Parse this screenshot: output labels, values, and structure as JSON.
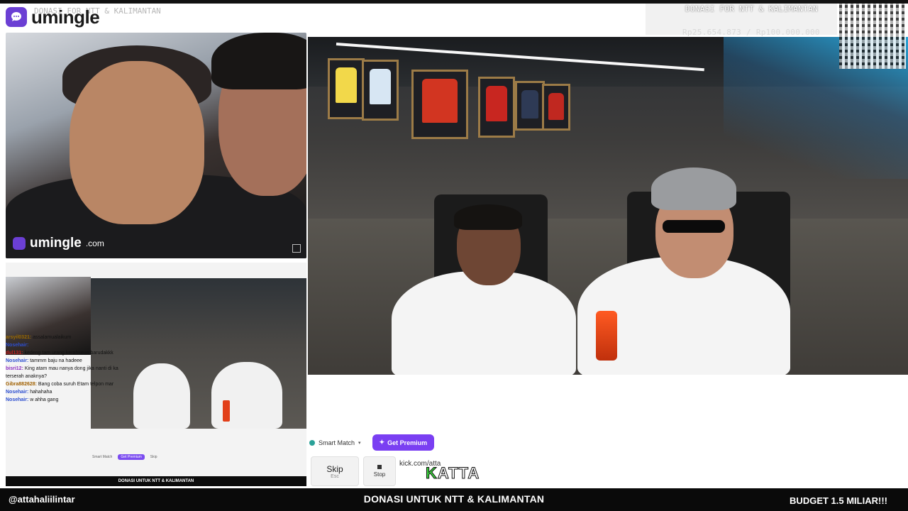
{
  "brand": {
    "logo_text": "umingle",
    "ghost_title": "DONASI FOR NTT & KALIMANTAN",
    "watermark_name": "umingle",
    "watermark_domain": ".com"
  },
  "donation": {
    "title": "DONASI FOR NTT & KALIMANTAN",
    "amount": "Rp25.654.873 / Rp100.000.000"
  },
  "nested_stream": {
    "chat": [
      {
        "user": "arsyil0321:",
        "text": " assalamualaikum"
      },
      {
        "user": "Nosehair:",
        "text": ""
      },
      {
        "user": "dul131:",
        "text": " kedeng tam urang kerahkeun barudakkk"
      },
      {
        "user": "Nosehair:",
        "text": " tammm baju na hadeee"
      },
      {
        "user": "bisri12:",
        "text": " King atam mau nanya dong jika nanti di ka terserah anaknya?"
      },
      {
        "user": "Gibra882628:",
        "text": " Bang coba suruh Etam telpon mar"
      },
      {
        "user": "Nosehair:",
        "text": " hahahaha"
      },
      {
        "user": "Nosehair:",
        "text": " w ahha gang"
      }
    ],
    "smart_match": "Smart Match",
    "premium": "Get Premium",
    "skip": "Skip",
    "footer": "DONASI UNTUK NTT & KALIMANTAN"
  },
  "controls": {
    "smart_match": "Smart Match",
    "premium": "Get Premium",
    "skip_label": "Skip",
    "skip_hint": "Esc",
    "stop_label": "Stop",
    "chat_text": "kick.com/atta",
    "overlay_text_k": "K",
    "overlay_text_rest": "ATTA"
  },
  "bottom_bar": {
    "left": "@attahaliilintar",
    "center": "DONASI UNTUK NTT & KALIMANTAN",
    "right": "BUDGET 1.5 MILIAR!!!"
  },
  "colors": {
    "brand_purple": "#6b3fd4",
    "premium_purple": "#7a3ff2",
    "kick_green": "#3bd23d",
    "bar_black": "#0a0a0a"
  }
}
